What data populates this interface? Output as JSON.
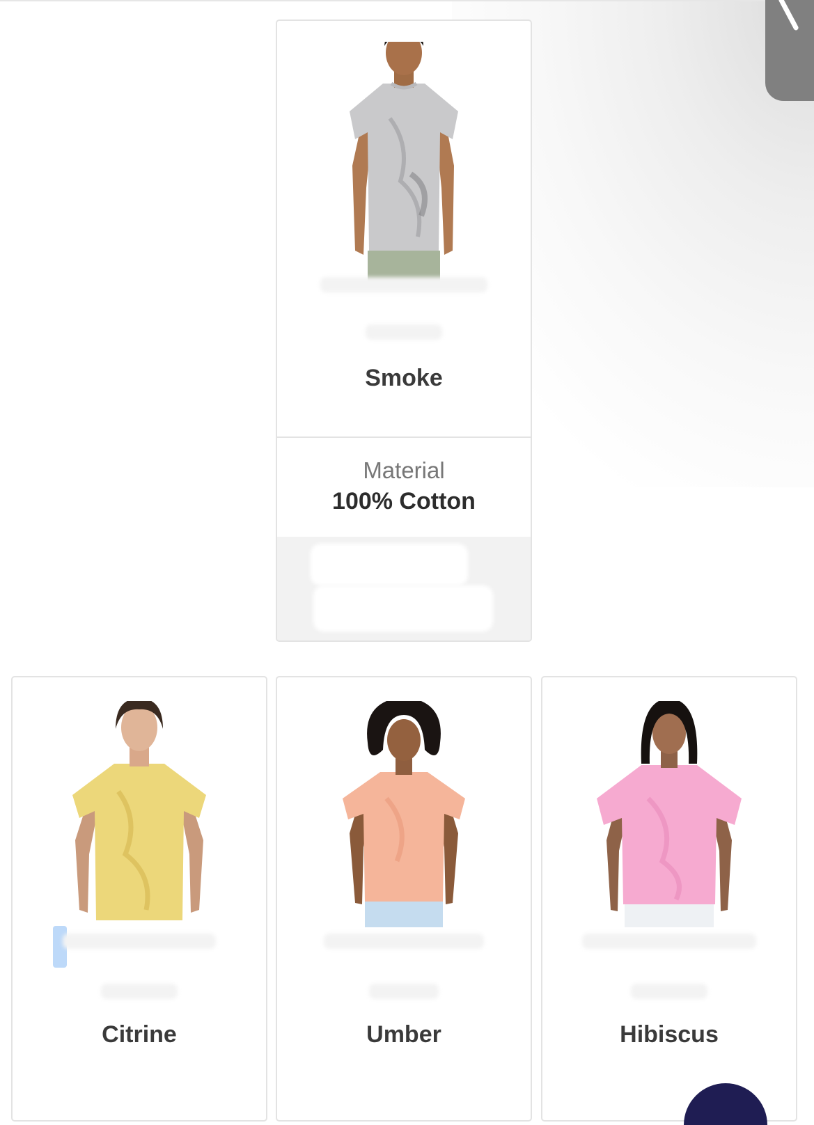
{
  "featured": {
    "color_name": "Smoke",
    "shirt_color": "#c9c9cb",
    "material_label": "Material",
    "material_value": "100% Cotton"
  },
  "products": [
    {
      "color_name": "Citrine",
      "shirt_color": "#ecd77a"
    },
    {
      "color_name": "Umber",
      "shirt_color": "#f5b59a"
    },
    {
      "color_name": "Hibiscus",
      "shirt_color": "#f6aad0"
    }
  ],
  "colors": {
    "card_border": "#e3e3e3",
    "text_dark": "#3a3a3a",
    "text_muted": "#777777",
    "chat_bubble": "#1f1d53"
  }
}
